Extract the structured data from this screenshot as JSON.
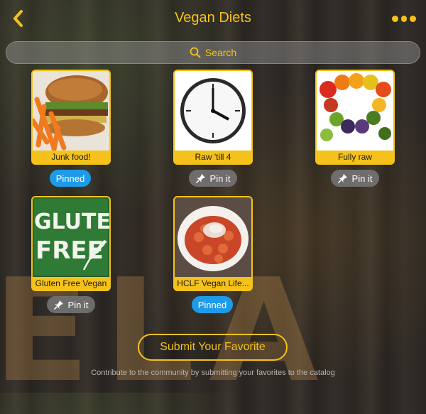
{
  "header": {
    "title": "Vegan Diets",
    "back_icon": "chevron-left-icon",
    "more_icon": "more-horizontal-icon"
  },
  "search": {
    "placeholder": "Search",
    "icon": "search-icon"
  },
  "items": [
    {
      "label": "Junk food!",
      "status": "Pinned"
    },
    {
      "label": "Raw 'till 4",
      "status": "Pin it"
    },
    {
      "label": "Fully raw",
      "status": "Pin it"
    },
    {
      "label": "Gluten Free Vegan",
      "status": "Pin it"
    },
    {
      "label": "HCLF Vegan Life...",
      "status": "Pinned"
    }
  ],
  "gluten_free_art": {
    "line1": "GLUTEN",
    "line2": "FREE"
  },
  "submit": {
    "label": "Submit Your Favorite"
  },
  "footnote": "Contribute to the community by submitting your favorites to the catalog",
  "colors": {
    "accent": "#f4c21a",
    "pinned": "#1e9be8",
    "pin": "#787878"
  }
}
